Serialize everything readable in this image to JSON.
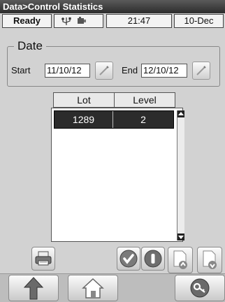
{
  "window": {
    "title": "Data>Control Statistics"
  },
  "status": {
    "state": "Ready",
    "time": "21:47",
    "date": "10-Dec"
  },
  "date_filter": {
    "group_label": "Date",
    "start_label": "Start",
    "start_value": "11/10/12",
    "end_label": "End",
    "end_value": "12/10/12"
  },
  "table": {
    "columns": [
      "Lot",
      "Level"
    ],
    "rows": [
      {
        "lot": "1289",
        "level": "2"
      }
    ]
  },
  "icons": {
    "usb": "usb-icon",
    "connection": "connection-icon",
    "date_picker": "pencil-icon",
    "print": "printer-icon",
    "accept": "checkmark-icon",
    "info": "info-icon",
    "doc_up": "document-up-icon",
    "doc_down": "document-down-icon",
    "back": "up-arrow-icon",
    "home": "home-icon",
    "keys": "key-icon"
  },
  "colors": {
    "title_bar": "#3a3a3a",
    "selection": "#2b2b2b",
    "background": "#d2d2d2"
  }
}
